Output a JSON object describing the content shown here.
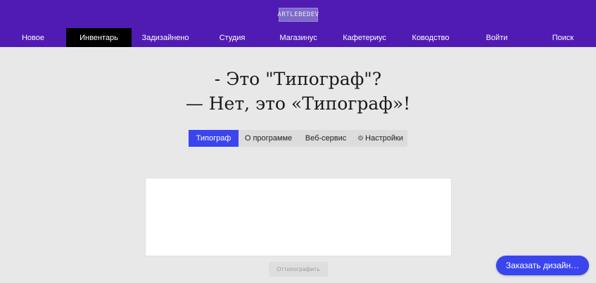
{
  "header": {
    "logo_text": "ARTLEBEDEV",
    "nav": [
      {
        "label": "Новое",
        "active": false
      },
      {
        "label": "Инвентарь",
        "active": true
      },
      {
        "label": "Задизайнено",
        "active": false
      },
      {
        "label": "Студия",
        "active": false
      },
      {
        "label": "Магазинус",
        "active": false
      },
      {
        "label": "Кафетериус",
        "active": false
      },
      {
        "label": "Ководство",
        "active": false
      },
      {
        "label": "Войти",
        "active": false
      },
      {
        "label": "Поиск",
        "active": false
      }
    ]
  },
  "main": {
    "headline_line1": "- Это \"Типограф\"?",
    "headline_line2": "— Нет, это «Типограф»!",
    "tabs": [
      {
        "label": "Типограф",
        "active": true
      },
      {
        "label": "О программе",
        "active": false
      },
      {
        "label": "Веб-сервис",
        "active": false
      },
      {
        "label": "Настройки",
        "active": false
      }
    ],
    "editor_value": "",
    "submit_label": "Оттипографить"
  },
  "order_button_label": "Заказать дизайн…",
  "colors": {
    "header_bg": "#501bb2",
    "accent": "#3a45ee",
    "page_bg": "#e8e8e8"
  }
}
